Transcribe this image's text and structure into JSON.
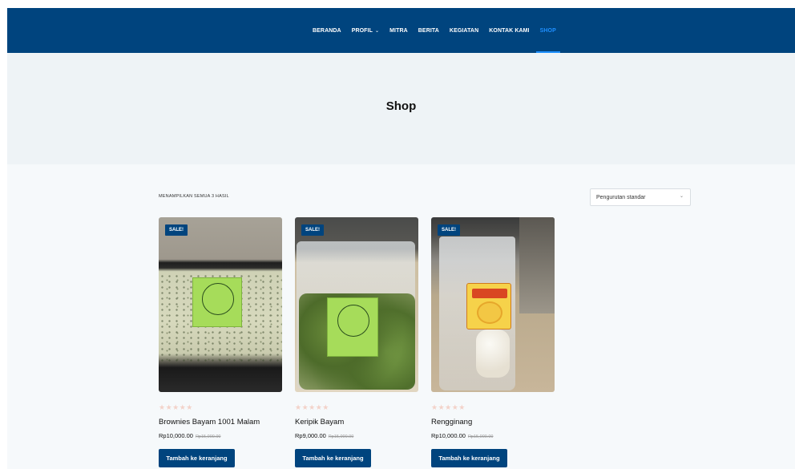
{
  "nav": {
    "items": [
      {
        "label": "BERANDA",
        "active": false,
        "dropdown": false
      },
      {
        "label": "PROFIL",
        "active": false,
        "dropdown": true
      },
      {
        "label": "MITRA",
        "active": false,
        "dropdown": false
      },
      {
        "label": "BERITA",
        "active": false,
        "dropdown": false
      },
      {
        "label": "KEGIATAN",
        "active": false,
        "dropdown": false
      },
      {
        "label": "KONTAK KAMI",
        "active": false,
        "dropdown": false
      },
      {
        "label": "SHOP",
        "active": true,
        "dropdown": false
      }
    ]
  },
  "hero": {
    "title": "Shop"
  },
  "shop": {
    "result_count": "MENAMPILKAN SEMUA 3 HASIL",
    "sort_selected": "Pengurutan standar",
    "products": [
      {
        "name": "Brownies Bayam 1001 Malam",
        "price": "Rp10,000.00",
        "old_price": "Rp15,000.00",
        "badge": "SALE!",
        "stars": "★★★★★",
        "button": "Tambah ke keranjang"
      },
      {
        "name": "Keripik Bayam",
        "price": "Rp9,000.00",
        "old_price": "Rp15,000.00",
        "badge": "SALE!",
        "stars": "★★★★★",
        "button": "Tambah ke keranjang"
      },
      {
        "name": "Rengginang",
        "price": "Rp10,000.00",
        "old_price": "Rp15,000.00",
        "badge": "SALE!",
        "stars": "★★★★★",
        "button": "Tambah ke keranjang"
      }
    ]
  },
  "colors": {
    "primary": "#00447e",
    "active_link": "#1e8fff",
    "hero_bg": "#eef3f6"
  },
  "icons": {
    "dropdown": "chevron-down-icon",
    "rating": "star-icon"
  }
}
